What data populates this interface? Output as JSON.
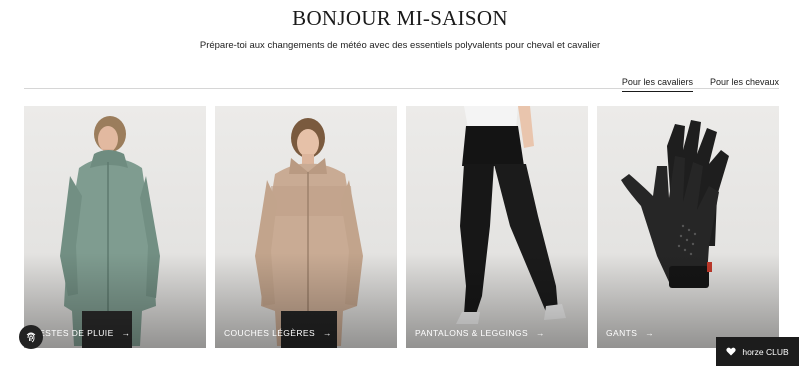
{
  "header": {
    "title": "BONJOUR MI-SAISON",
    "subtitle": "Prépare-toi aux changements de météo avec des essentiels polyvalents pour cheval et cavalier"
  },
  "tabs": [
    {
      "label": "Pour les cavaliers",
      "active": true
    },
    {
      "label": "Pour les chevaux",
      "active": false
    }
  ],
  "cards": [
    {
      "label": "VESTES DE PLUIE",
      "arrow": "→",
      "image": "woman-green-rain-jacket"
    },
    {
      "label": "COUCHES LÉGÈRES",
      "arrow": "→",
      "image": "woman-beige-fleece"
    },
    {
      "label": "PANTALONS & LEGGINGS",
      "arrow": "→",
      "image": "black-riding-leggings"
    },
    {
      "label": "GANTS",
      "arrow": "→",
      "image": "black-riding-gloves"
    }
  ],
  "floating": {
    "fingerprint_icon": "fingerprint-icon",
    "club_label": "horze CLUB",
    "club_icon": "heart-icon"
  }
}
